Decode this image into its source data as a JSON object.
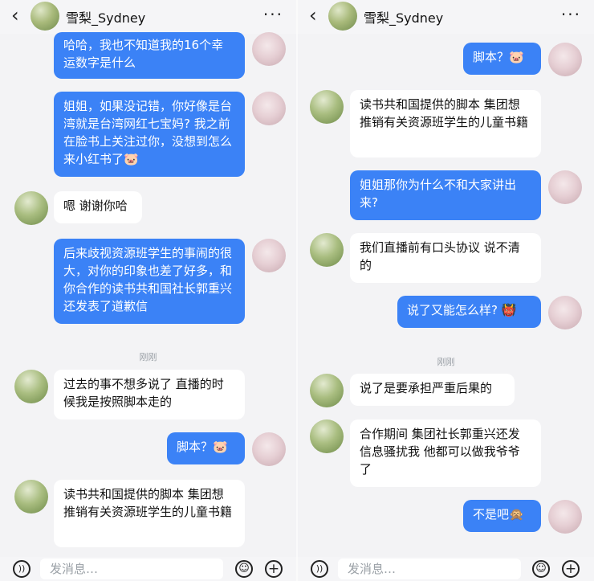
{
  "left": {
    "header": {
      "back": "‹",
      "title": "雪梨_Sydney",
      "more": "···"
    },
    "messages": [
      {
        "from": "me",
        "text": "哈哈，我也不知道我的16个幸运数字是什么"
      },
      {
        "from": "me",
        "text": "姐姐，如果没记错，你好像是台湾就是台湾网红七宝妈? 我之前在脸书上关注过你，没想到怎么来小红书了🐷"
      },
      {
        "from": "other",
        "text": "嗯 谢谢你哈"
      },
      {
        "from": "me",
        "text": "后来歧视资源班学生的事闹的很大，对你的印象也差了好多，和你合作的读书共和国社长郭重兴还发表了道歉信"
      },
      {
        "time": "刚刚"
      },
      {
        "from": "other",
        "text": "过去的事不想多说了 直播的时候我是按照脚本走的"
      },
      {
        "from": "me",
        "text": "脚本？🐷"
      },
      {
        "from": "other",
        "text": "读书共和国提供的脚本 集团想推销有关资源班学生的儿童书籍"
      }
    ],
    "input": {
      "placeholder": "发消息…"
    }
  },
  "right": {
    "header": {
      "back": "‹",
      "title": "雪梨_Sydney",
      "more": "···"
    },
    "messages": [
      {
        "from": "me",
        "text": "脚本？🐷"
      },
      {
        "from": "other",
        "text": "读书共和国提供的脚本 集团想推销有关资源班学生的儿童书籍"
      },
      {
        "from": "me",
        "text": "姐姐那你为什么不和大家讲出来?"
      },
      {
        "from": "other",
        "text": "我们直播前有口头协议 说不清的"
      },
      {
        "from": "me",
        "text": "说了又能怎么样? 👹"
      },
      {
        "time": "刚刚"
      },
      {
        "from": "other",
        "text": "说了是要承担严重后果的"
      },
      {
        "from": "other",
        "text": "合作期间 集团社长郭重兴还发信息骚扰我 他都可以做我爷爷了"
      },
      {
        "from": "me",
        "text": "不是吧🙊"
      }
    ],
    "input": {
      "placeholder": "发消息…"
    }
  },
  "icons": {
    "voice": "voice-icon",
    "emoji": "emoji-icon",
    "plus": "plus-icon",
    "back": "back-arrow-icon",
    "more": "more-icon"
  },
  "colors": {
    "me_bubble": "#3b82f6",
    "other_bubble": "#ffffff",
    "background": "#f3f3f5"
  }
}
